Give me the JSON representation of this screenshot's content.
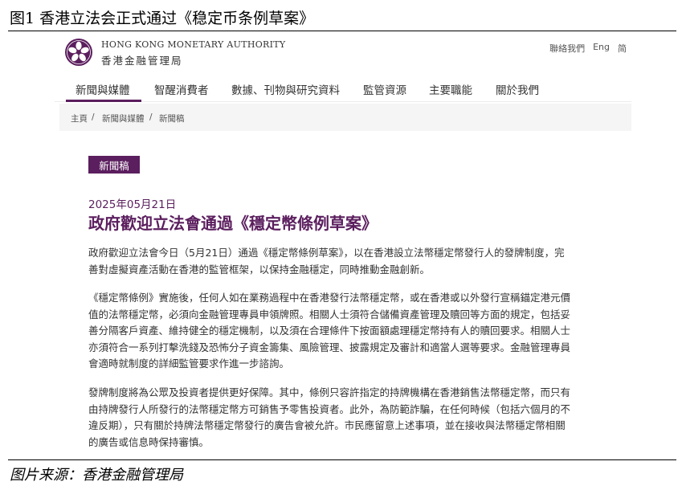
{
  "figure": {
    "title": "图1 香港立法会正式通过《稳定币条例草案》",
    "source": "图片来源：香港金融管理局"
  },
  "header": {
    "org_en": "HONG KONG MONETARY AUTHORITY",
    "org_zh": "香港金融管理局",
    "links": {
      "contact": "聯絡我們",
      "eng": "Eng",
      "simplified": "简"
    }
  },
  "nav": {
    "items": [
      "新聞與媒體",
      "智醒消費者",
      "數據、刊物與研究資料",
      "監管資源",
      "主要職能",
      "關於我們"
    ],
    "active_color": "#5b1e5e"
  },
  "breadcrumb": [
    "主頁",
    "/",
    "新聞與媒體",
    "/",
    "新聞稿"
  ],
  "article": {
    "badge": "新聞稿",
    "date": "2025年05月21日",
    "headline": "政府歡迎立法會通過《穩定幣條例草案》",
    "paragraphs": [
      [
        "政府歡迎立法會今日（5月21日）通過《穩定幣條例草案》，以在香港設立法幣穩定幣發行人的發牌制度，完",
        "善對虛擬資產活動在香港的監管框架，以保持金融穩定，同時推動金融創新。"
      ],
      [
        "《穩定幣條例》實施後，任何人如在業務過程中在香港發行法幣穩定幣，或在香港或以外發行宣稱錨定港元價",
        "值的法幣穩定幣，必須向金融管理專員申領牌照。相關人士須符合儲備資產管理及贖回等方面的規定，包括妥",
        "善分隔客戶資產、維持健全的穩定機制，以及須在合理條件下按面額處理穩定幣持有人的贖回要求。相關人士",
        "亦須符合一系列打擊洗錢及恐怖分子資金籌集、風險管理、披露規定及審計和適當人選等要求。金融管理專員",
        "會適時就制度的詳細監管要求作進一步諮詢。"
      ],
      [
        "發牌制度將為公眾及投資者提供更好保障。其中，條例只容許指定的持牌機構在香港銷售法幣穩定幣，而只有",
        "由持牌發行人所發行的法幣穩定幣方可銷售予零售投資者。此外，為防範詐騙，在任何時候（包括六個月的不",
        "違反期），只有關於持牌法幣穩定幣發行的廣告會被允許。市民應留意上述事項，並在接收與法幣穩定幣相關",
        "的廣告或信息時保持審慎。"
      ]
    ]
  },
  "colors": {
    "brand": "#5b1e5e",
    "breadcrumb_bg": "#f5f5f5"
  }
}
